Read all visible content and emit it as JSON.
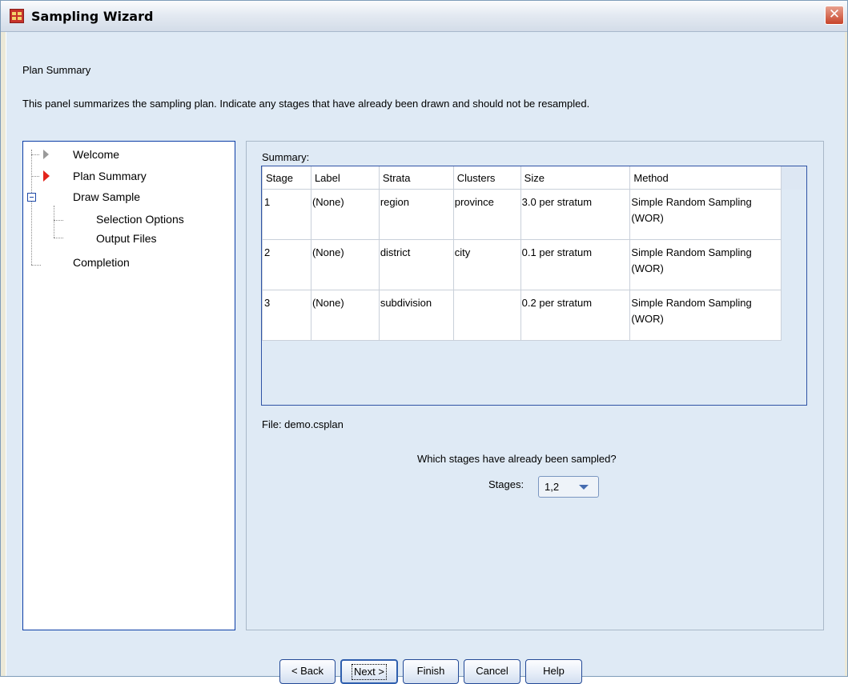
{
  "window": {
    "title": "Sampling Wizard",
    "close_symbol": "✕"
  },
  "page": {
    "heading": "Plan Summary",
    "description": "This panel summarizes the sampling plan. Indicate any stages that have already been drawn and should not be resampled."
  },
  "nav": {
    "items": [
      {
        "label": "Welcome",
        "icon": "arrow-grey-icon"
      },
      {
        "label": "Plan Summary",
        "icon": "arrow-red-icon",
        "current": true
      },
      {
        "label": "Draw Sample",
        "icon": "collapse-icon"
      },
      {
        "label": "Selection Options"
      },
      {
        "label": "Output Files"
      },
      {
        "label": "Completion"
      }
    ]
  },
  "summary": {
    "label": "Summary:",
    "columns": [
      "Stage",
      "Label",
      "Strata",
      "Clusters",
      "Size",
      "Method"
    ],
    "rows": [
      [
        "1",
        "(None)",
        "region",
        "province",
        "3.0 per stratum",
        "Simple Random Sampling (WOR)"
      ],
      [
        "2",
        "(None)",
        "district",
        "city",
        "0.1 per stratum",
        "Simple Random Sampling (WOR)"
      ],
      [
        "3",
        "(None)",
        "subdivision",
        "",
        "0.2 per stratum",
        "Simple Random Sampling (WOR)"
      ]
    ]
  },
  "file": {
    "text": "File:  demo.csplan"
  },
  "stages": {
    "question": "Which stages have already been sampled?",
    "label": "Stages:",
    "value": "1,2"
  },
  "buttons": {
    "back": "< Back",
    "next": "Next >",
    "finish": "Finish",
    "cancel": "Cancel",
    "help": "Help"
  },
  "colors": {
    "background": "#dfeaf5",
    "panel_border": "#0b3da6",
    "current_arrow": "#e3241b"
  }
}
